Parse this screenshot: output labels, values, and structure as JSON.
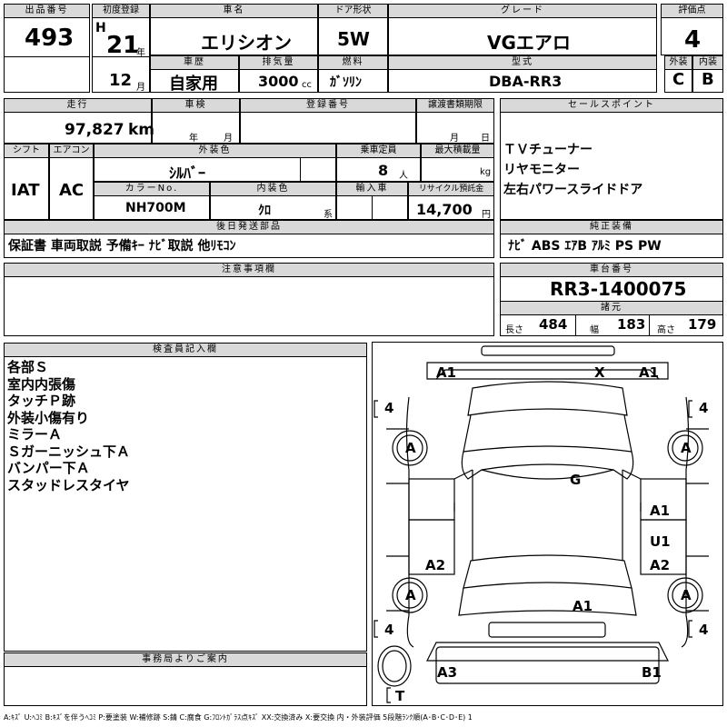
{
  "header": {
    "lot_no_label": "出品番号",
    "lot_no": "493",
    "first_reg_label": "初度登録",
    "era": "H",
    "year": "21",
    "year_unit": "年",
    "month": "12",
    "month_unit": "月",
    "car_name_label": "車名",
    "car_name": "エリシオン",
    "door_label": "ドア形状",
    "door": "5W",
    "grade_label": "グレード",
    "grade": "VGエアロ",
    "score_label": "評価点",
    "score": "4",
    "history_label": "車歴",
    "history": "自家用",
    "displacement_label": "排気量",
    "displacement": "3000",
    "displacement_unit": "cc",
    "fuel_label": "燃料",
    "fuel": "ｶﾞｿﾘﾝ",
    "model_label": "型式",
    "model": "DBA-RR3",
    "exterior_label": "外装",
    "exterior": "C",
    "interior_label": "内装",
    "interior": "B"
  },
  "row2": {
    "mileage_label": "走行",
    "mileage": "97,827",
    "mileage_unit": "km",
    "inspection_label": "車検",
    "year_unit": "年",
    "month_unit": "月",
    "reg_no_label": "登録番号",
    "transfer_label": "譲渡書類期限",
    "day_unit": "日",
    "sales_label": "セールスポイント",
    "sales_points": [
      "ＴＶチューナー",
      "リヤモニター",
      "左右パワースライドドア"
    ]
  },
  "row3": {
    "shift_label": "シフト",
    "shift": "IAT",
    "ac_label": "エアコン",
    "ac": "AC",
    "color_label": "外装色",
    "color": "ｼﾙﾊﾞｰ",
    "capacity_label": "乗車定員",
    "capacity": "8",
    "capacity_unit": "人",
    "load_label": "最大積載量",
    "load_unit": "kg",
    "color_no_label": "カラーNo.",
    "color_no": "NH700M",
    "int_color_label": "内装色",
    "int_color": "ｸﾛ",
    "int_color_unit": "系",
    "import_label": "輸入車",
    "recycle_label": "リサイクル預託金",
    "recycle": "14,700",
    "recycle_unit": "円"
  },
  "parts": {
    "label": "後日発送部品",
    "value": "保証書 車両取説 予備ｷｰ ﾅﾋﾞ取説 他ﾘﾓｺﾝ"
  },
  "equipment": {
    "label": "純正装備",
    "value": "ﾅﾋﾞ ABS ｴｱB ｱﾙﾐ PS PW"
  },
  "notes": {
    "label": "注意事項欄"
  },
  "chassis": {
    "label": "車台番号",
    "value": "RR3-1400075",
    "spec_label": "諸元",
    "length_label": "長さ",
    "length": "484",
    "width_label": "幅",
    "width": "183",
    "height_label": "高さ",
    "height": "179"
  },
  "inspector": {
    "label": "検査員記入欄",
    "lines": [
      "各部Ｓ",
      "室内内張傷",
      "タッチＰ跡",
      "外装小傷有り",
      "ミラーＡ",
      "Ｓガーニッシュ下Ａ",
      "バンパー下Ａ",
      "スタッドレスタイヤ"
    ]
  },
  "office": {
    "label": "事務局よりご案内"
  },
  "diagram": {
    "marks": [
      "A1",
      "X",
      "A1",
      "4",
      "4",
      "A",
      "A",
      "G",
      "A1",
      "U1",
      "A2",
      "A2",
      "A",
      "A",
      "A1",
      "4",
      "4",
      "A3",
      "B1",
      "T"
    ]
  },
  "legend": "A:ｷｽﾞ U:ﾍｺﾐ B:ｷｽﾞを伴うﾍｺﾐ P:要塗装 W:補修跡 S:錆 C:腐食 G:ﾌﾛﾝﾄｶﾞﾗｽ点ｷｽﾞ XX:交換済み X:要交換 内・外装評価 5段階ﾗﾝｸ順(A･B･C･D･E) 1"
}
